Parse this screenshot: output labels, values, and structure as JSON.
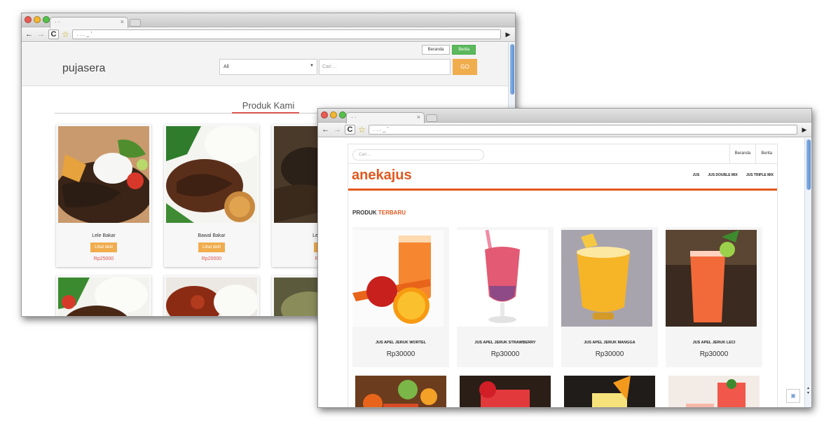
{
  "window1": {
    "tab_title": "· ·",
    "tab_close": "×",
    "url": ". . .                    _     '",
    "nav": {
      "beranda": "Beranda",
      "berita": "Berita"
    },
    "logo": "pujasera",
    "category_select": "All",
    "search_placeholder": "Cari ...",
    "go_label": "GO",
    "section_title": "Produk Kami",
    "products": [
      {
        "name": "Lele Bakar",
        "button": "Lihat detil",
        "price": "Rp25000"
      },
      {
        "name": "Bawal Bakar",
        "button": "Lihat detil",
        "price": "Rp20000"
      },
      {
        "name": "Lele E",
        "button": "Li",
        "price": "Rp2"
      }
    ],
    "accent_color": "#f0ad4e",
    "price_color": "#d9534f"
  },
  "window2": {
    "tab_title": "· ·",
    "tab_close": "×",
    "url": ". . .                    _     '",
    "search_placeholder": "Cari ...",
    "top_links": {
      "beranda": "Beranda",
      "berita": "Berita"
    },
    "logo": "anekajus",
    "menu": {
      "jus": "JUS",
      "double": "JUS DOUBLE MIX",
      "triple": "JUS TRIPLE MIX"
    },
    "section_prefix": "PRODUK",
    "section_highlight": "TERBARU",
    "products": [
      {
        "name": "JUS APEL JERUK WORTEL",
        "price": "Rp30000"
      },
      {
        "name": "JUS APEL JERUK STRAWBERRY",
        "price": "Rp30000"
      },
      {
        "name": "JUS APEL JERUK MANGGA",
        "price": "Rp30000"
      },
      {
        "name": "JUS APEL JERUK LECI",
        "price": "Rp30000"
      }
    ],
    "brand_color": "#e2571d"
  },
  "icons": [
    "back-icon",
    "forward-icon",
    "reload-icon",
    "bookmark-star-icon",
    "go-arrow-icon",
    "broken-image-icon"
  ]
}
